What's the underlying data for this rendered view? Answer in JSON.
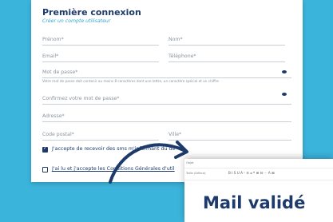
{
  "form": {
    "title": "Première connexion",
    "subtitle": "Créer un compte utilisateur",
    "fields": {
      "prenom": "Prénom*",
      "nom": "Nom*",
      "email": "Email*",
      "telephone": "Téléphone*",
      "password": "Mot de passe*",
      "password_hint": "Votre mot de passe doit contenir au moins 8 caractères dont une lettre, un caractère spécial et un chiffre",
      "confirm_password": "Confirmez votre mot de passe*",
      "adresse": "Adresse*",
      "code_postal": "Code postal*",
      "ville": "Ville*"
    },
    "checkboxes": {
      "sms": {
        "label": "J'accepte de recevoir des sms m'informant du dé",
        "checked": true
      },
      "cgu": {
        "label": "J'ai lu et j'accepte les Conditions Générales d'util",
        "checked": false
      }
    }
  },
  "editor_panel": {
    "toolbar_labels": [
      "Objet",
      "Taille (Défaut)"
    ],
    "toolbar_icons": "B I S U A ⁿ ≡ ⌀ ❝ ⊞ ⊟ ⋯ A ⊠",
    "headline": "Mail validé"
  },
  "colors": {
    "background": "#3bb4dc",
    "primary": "#1d3a6b",
    "accent": "#33a9cf"
  }
}
